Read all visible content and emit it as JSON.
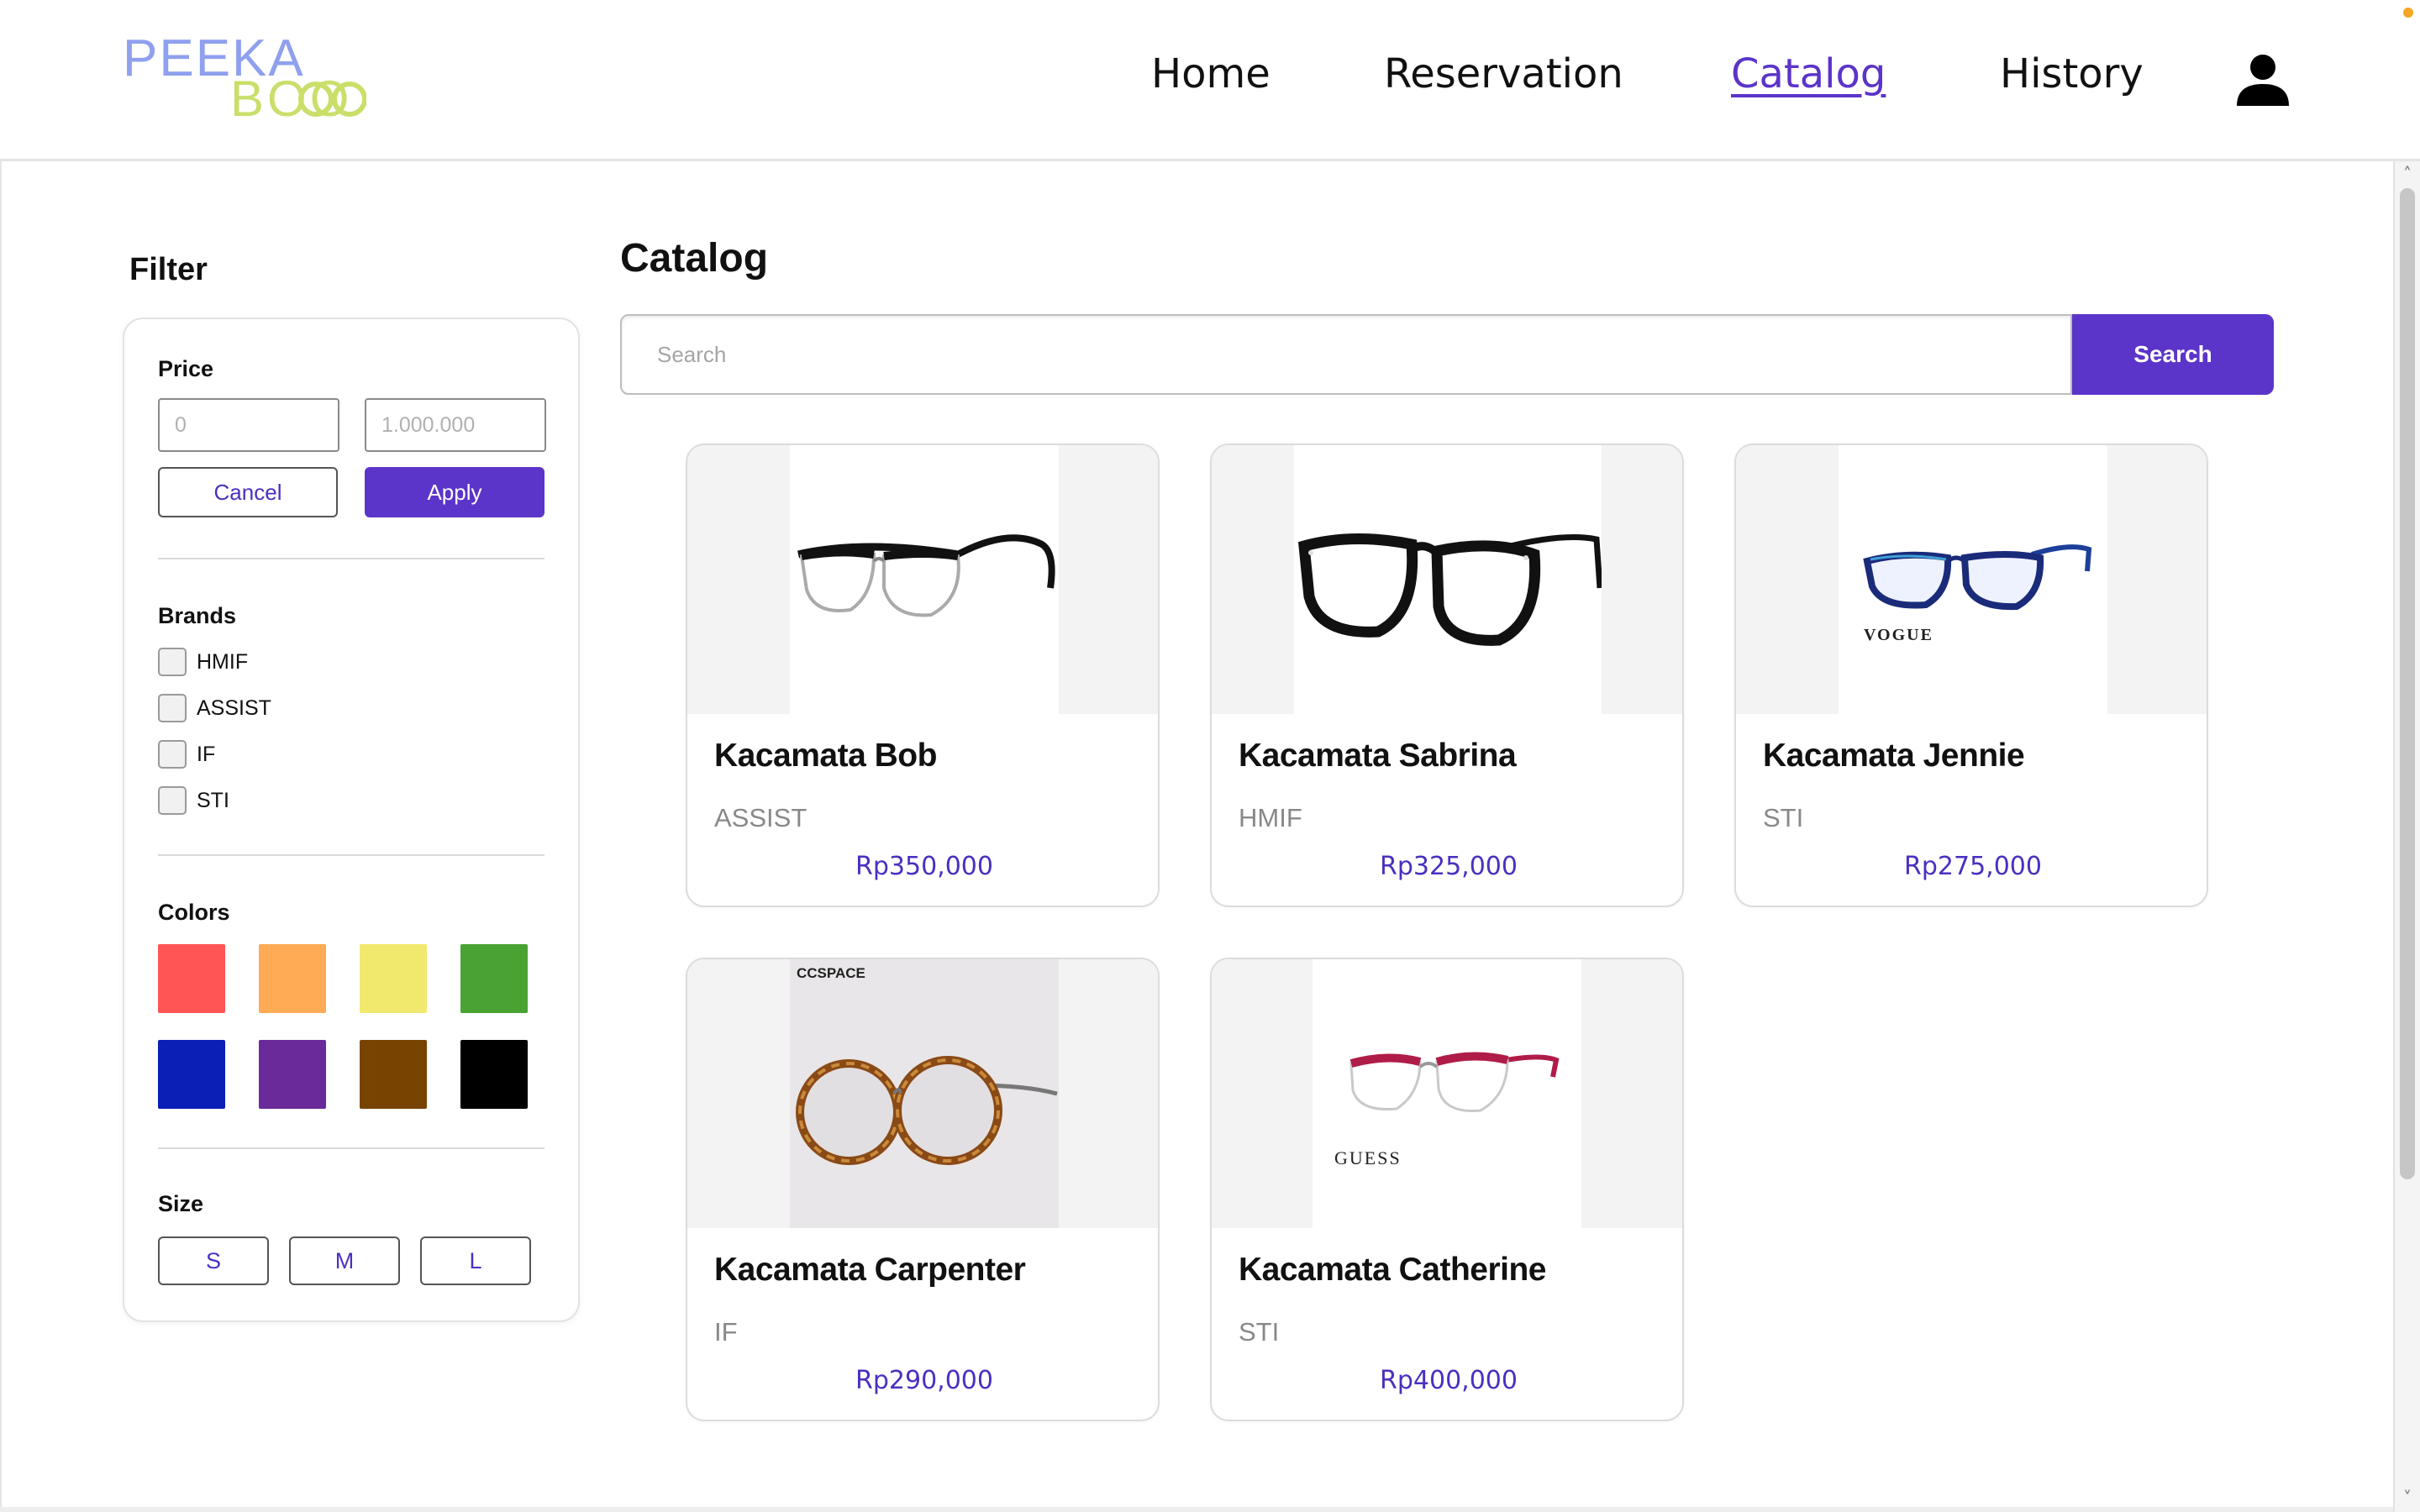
{
  "header": {
    "logo_top": "PEEKA",
    "logo_bottom": "BOO",
    "nav": [
      "Home",
      "Reservation",
      "Catalog",
      "History"
    ],
    "active_nav": "Catalog",
    "icons": {
      "user": "user-icon"
    }
  },
  "filter": {
    "title": "Filter",
    "price": {
      "label": "Price",
      "min_placeholder": "0",
      "max_placeholder": "1.000.000",
      "cancel_label": "Cancel",
      "apply_label": "Apply"
    },
    "brands": {
      "label": "Brands",
      "items": [
        "HMIF",
        "ASSIST",
        "IF",
        "STI"
      ]
    },
    "colors": {
      "label": "Colors",
      "swatches": [
        "#ff5555",
        "#ffaa55",
        "#f0e96e",
        "#4aa232",
        "#0a1fb5",
        "#6a2a9a",
        "#774400",
        "#000000"
      ]
    },
    "size": {
      "label": "Size",
      "options": [
        "S",
        "M",
        "L"
      ]
    }
  },
  "catalog": {
    "title": "Catalog",
    "search_placeholder": "Search",
    "search_button": "Search",
    "products": [
      {
        "name": "Kacamata Bob",
        "brand": "ASSIST",
        "price": "Rp350,000"
      },
      {
        "name": "Kacamata Sabrina",
        "brand": "HMIF",
        "price": "Rp325,000"
      },
      {
        "name": "Kacamata Jennie",
        "brand": "STI",
        "price": "Rp275,000",
        "image_text": "VOGUE"
      },
      {
        "name": "Kacamata Carpenter",
        "brand": "IF",
        "price": "Rp290,000",
        "image_text": "CCSPACE"
      },
      {
        "name": "Kacamata Catherine",
        "brand": "STI",
        "price": "Rp400,000",
        "image_text": "GUESS"
      }
    ]
  },
  "theme": {
    "accent": "#5b34c9",
    "logo_blue": "#8fa0ee",
    "logo_green": "#c9df6a"
  }
}
